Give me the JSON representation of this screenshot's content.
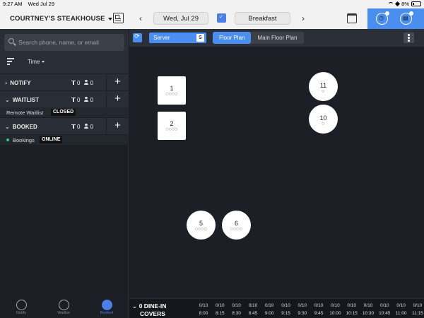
{
  "status_bar": {
    "time": "9:27 AM",
    "date": "Wed Jul 29",
    "battery": "8%"
  },
  "header": {
    "venue": "COURTNEY'S STEAKHOUSE",
    "prev": "‹",
    "next": "›",
    "date": "Wed, Jul 29",
    "service": "Breakfast",
    "accent": "#4a8ff0"
  },
  "search": {
    "placeholder": "Search phone, name, or email"
  },
  "sort": {
    "label": "Time"
  },
  "sections": [
    {
      "title": "NOTIFY",
      "chevron": "›",
      "tables": "0",
      "covers": "0",
      "add": "+"
    },
    {
      "title": "WAITLIST",
      "chevron": "⌄",
      "tables": "0",
      "covers": "0",
      "add": "+"
    },
    {
      "title": "BOOKED",
      "chevron": "⌄",
      "tables": "0",
      "covers": "0",
      "add": "+"
    }
  ],
  "remote_waitlist": {
    "label": "Remote Waitlist",
    "status": "CLOSED"
  },
  "bookings": {
    "label": "Bookings",
    "status": "ONLINE"
  },
  "bottom_nav": [
    {
      "label": "Notify",
      "icon": "bell-icon"
    },
    {
      "label": "Waitlist",
      "icon": "clock-icon"
    },
    {
      "label": "Booked",
      "icon": "book-icon"
    }
  ],
  "floor_toolbar": {
    "server_label": "Server",
    "server_badge": "S",
    "tabs": [
      "Floor Plan",
      "Main Floor Plan"
    ]
  },
  "tables": [
    {
      "number": "1",
      "shape": "square",
      "seats": "○○○○"
    },
    {
      "number": "2",
      "shape": "square",
      "seats": "○○○○"
    },
    {
      "number": "11",
      "shape": "round",
      "seats": "○"
    },
    {
      "number": "10",
      "shape": "round",
      "seats": "○"
    },
    {
      "number": "5",
      "shape": "round",
      "seats": "○○○○"
    },
    {
      "number": "6",
      "shape": "round",
      "seats": "○○○○"
    }
  ],
  "timeline": {
    "covers_line1": "0 DINE-IN",
    "covers_line2": "COVERS",
    "slots": [
      {
        "count": "0/10",
        "time": "8:00"
      },
      {
        "count": "0/10",
        "time": "8:15"
      },
      {
        "count": "0/10",
        "time": "8:30"
      },
      {
        "count": "0/10",
        "time": "8:45"
      },
      {
        "count": "0/10",
        "time": "9:00"
      },
      {
        "count": "0/10",
        "time": "9:15"
      },
      {
        "count": "0/10",
        "time": "9:30"
      },
      {
        "count": "0/10",
        "time": "9:45"
      },
      {
        "count": "0/10",
        "time": "10:00"
      },
      {
        "count": "0/10",
        "time": "10:15"
      },
      {
        "count": "0/10",
        "time": "10:30"
      },
      {
        "count": "0/10",
        "time": "10:45"
      },
      {
        "count": "0/10",
        "time": "11:00"
      },
      {
        "count": "0/10",
        "time": "11:15"
      }
    ]
  }
}
